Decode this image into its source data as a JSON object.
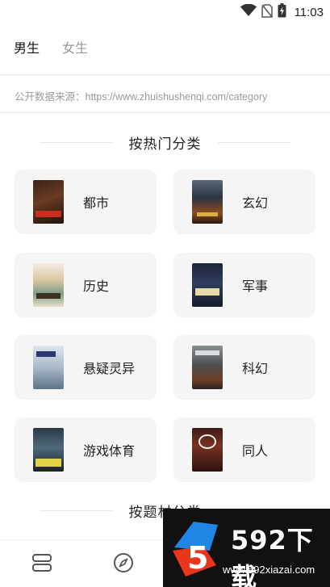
{
  "status_bar": {
    "time": "11:03",
    "icons": [
      "wifi-icon",
      "no-sim-icon",
      "battery-charging-icon"
    ]
  },
  "gender_tabs": [
    {
      "label": "男生",
      "active": true
    },
    {
      "label": "女生",
      "active": false
    }
  ],
  "source_text": "公开数据来源：https://www.zhuishushenqi.com/category",
  "sections": [
    {
      "title": "按热门分类"
    },
    {
      "title": "按题材分类"
    }
  ],
  "categories": [
    {
      "label": "都市"
    },
    {
      "label": "玄幻"
    },
    {
      "label": "历史"
    },
    {
      "label": "军事"
    },
    {
      "label": "悬疑灵异"
    },
    {
      "label": "科幻"
    },
    {
      "label": "游戏体育"
    },
    {
      "label": "同人"
    }
  ],
  "bottom_nav": {
    "icons": [
      "bookshelf-icon",
      "compass-icon",
      "user-icon"
    ]
  },
  "watermark": {
    "logo_digit": "5",
    "text": "592下载",
    "url": "www.592xiazai.com"
  },
  "colors": {
    "card_bg": "#f5f5f5",
    "watermark_accent": "#e8361c",
    "watermark_blue": "#1f86e6"
  }
}
